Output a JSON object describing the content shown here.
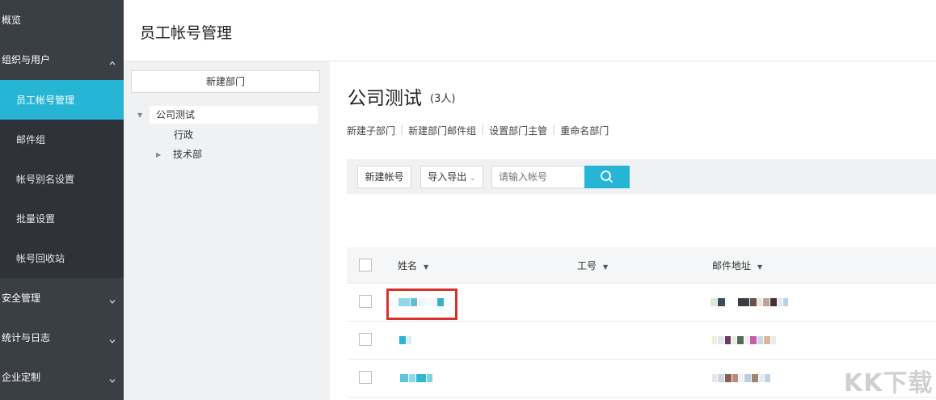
{
  "sidebar": {
    "groups": [
      {
        "label": "概览"
      },
      {
        "label": "组织与用户"
      },
      {
        "label": "安全管理"
      },
      {
        "label": "统计与日志"
      },
      {
        "label": "企业定制"
      }
    ],
    "sub_items": [
      {
        "label": "员工帐号管理",
        "active": true
      },
      {
        "label": "邮件组"
      },
      {
        "label": "帐号别名设置"
      },
      {
        "label": "批量设置"
      },
      {
        "label": "帐号回收站"
      }
    ]
  },
  "header": {
    "title": "员工帐号管理"
  },
  "tree": {
    "new_dept_label": "新建部门",
    "nodes": [
      {
        "label": "公司测试"
      },
      {
        "label": "行政"
      },
      {
        "label": "技术部"
      }
    ]
  },
  "main": {
    "dept_name": "公司测试",
    "dept_count": "(3人)",
    "actions": [
      "新建子部门",
      "新建部门邮件组",
      "设置部门主管",
      "重命名部门"
    ],
    "toolbar": {
      "new_account": "新建帐号",
      "import_export": "导入导出",
      "search_placeholder": "请输入帐号"
    },
    "table": {
      "columns": [
        "姓名",
        "工号",
        "邮件地址"
      ]
    }
  },
  "colors": {
    "sidebar_bg": "#3a3e45",
    "accent": "#27b5d6",
    "highlight_border": "#d9312b"
  },
  "watermark": "KK下载"
}
